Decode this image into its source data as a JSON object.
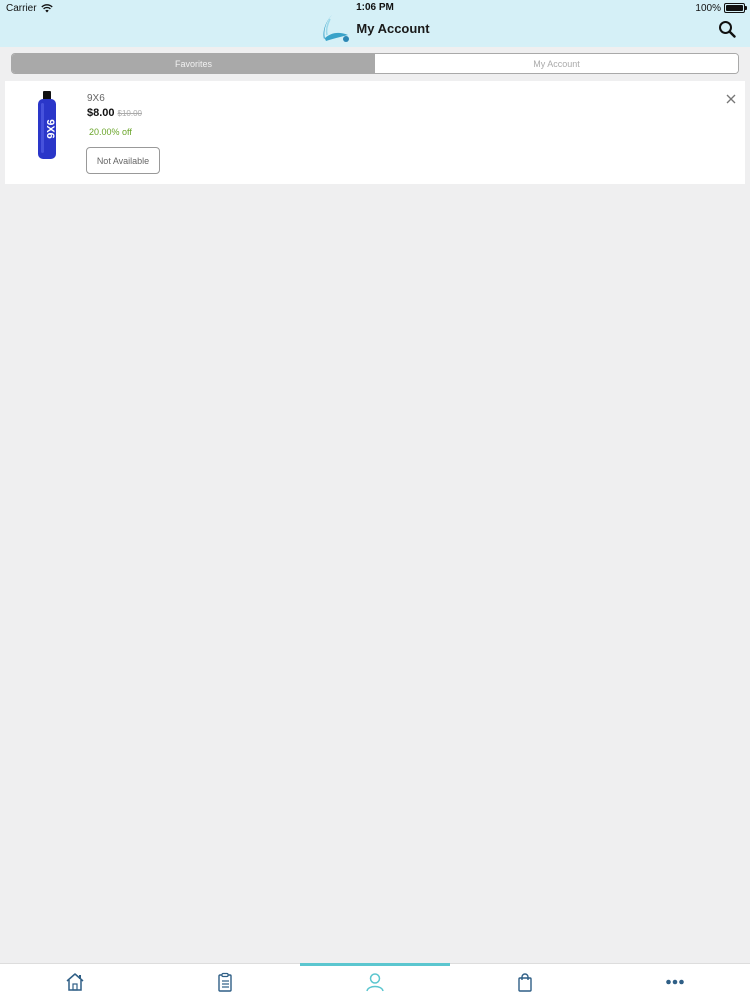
{
  "status_bar": {
    "carrier": "Carrier",
    "time": "1:06 PM",
    "battery": "100%"
  },
  "nav": {
    "title": "My Account",
    "logo_icon": "droplet-logo-icon",
    "search_icon": "search-icon"
  },
  "segments": {
    "favorites": "Favorites",
    "my_account": "My Account",
    "selected": "Favorites"
  },
  "favorite_item": {
    "name": "9X6",
    "price": "$8.00",
    "original_price": "$10.00",
    "discount": "20.00% off",
    "availability_button": "Not Available",
    "remove_icon": "close-icon",
    "image_label": "9X6"
  },
  "tab_bar": {
    "items": [
      {
        "icon": "home-icon"
      },
      {
        "icon": "clipboard-list-icon"
      },
      {
        "icon": "user-icon"
      },
      {
        "icon": "shopping-bag-icon"
      },
      {
        "icon": "more-dots-icon"
      }
    ],
    "selected_index": 2
  },
  "colors": {
    "header_bg": "#d5f0f7",
    "accent": "#5bc6cf",
    "discount": "#6aa52a",
    "segment_active": "#a9a9a9",
    "icon_blue": "#2f5f86"
  }
}
